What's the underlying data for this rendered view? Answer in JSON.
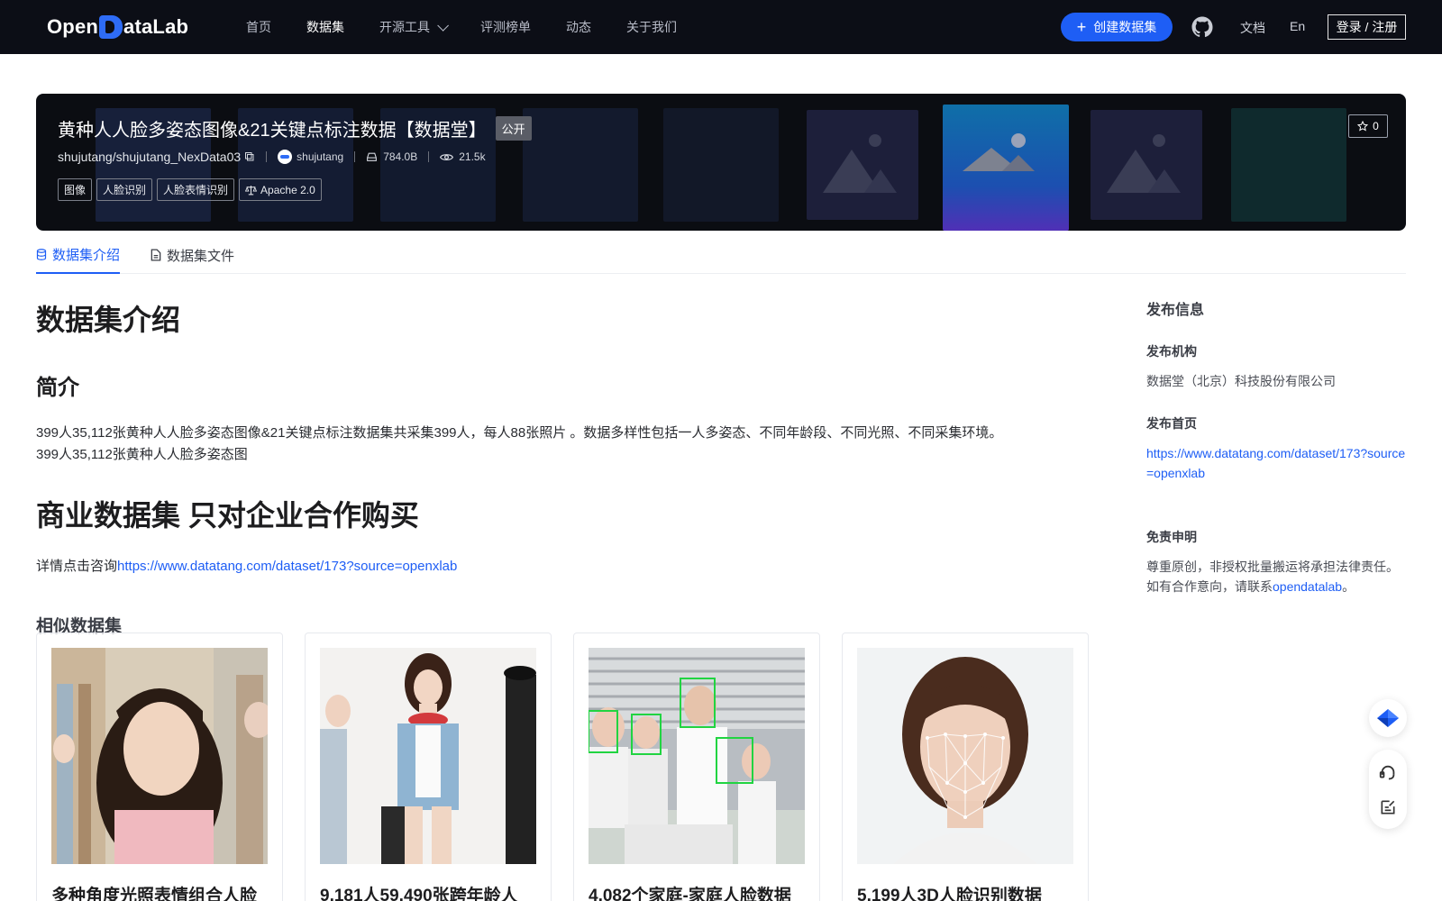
{
  "nav": {
    "logo_text_a": "Open",
    "logo_text_b": "ataLab",
    "links": [
      "首页",
      "数据集",
      "开源工具",
      "评测榜单",
      "动态",
      "关于我们"
    ],
    "active_index": 1,
    "create_label": "创建数据集",
    "docs_label": "文档",
    "lang_label": "En",
    "login_label": "登录 / 注册"
  },
  "dataset": {
    "title": "黄种人人脸多姿态图像&21关键点标注数据【数据堂】",
    "visibility": "公开",
    "star_count": "0",
    "repo": "shujutang/shujutang_NexData03",
    "owner": "shujutang",
    "size": "784.0B",
    "views": "21.5k",
    "tags": [
      "图像",
      "人脸识别",
      "人脸表情识别"
    ],
    "license": "Apache 2.0"
  },
  "tabs": [
    "数据集介绍",
    "数据集文件"
  ],
  "content": {
    "h1": "数据集介绍",
    "h2": "简介",
    "intro_line1": "399人35,112张黄种人人脸多姿态图像&21关键点标注数据集共采集399人，每人88张照片 。数据多样性包括一人多姿态、不同年龄段、不同光照、不同采集环境。",
    "intro_line2": "399人35,112张黄种人人脸多姿态图",
    "commercial": "商业数据集 只对企业合作购买",
    "consult_prefix": "详情点击咨询",
    "consult_link": "https://www.datatang.com/dataset/173?source=openxlab",
    "similar_title": "相似数据集"
  },
  "cards": [
    {
      "title": "多种角度光照表情组合人脸"
    },
    {
      "title": "9,181人59,490张跨年龄人"
    },
    {
      "title": "4,082个家庭-家庭人脸数据"
    },
    {
      "title": "5,199人3D人脸识别数据"
    }
  ],
  "sidebar": {
    "heading": "发布信息",
    "org_label": "发布机构",
    "org_value": "数据堂（北京）科技股份有限公司",
    "home_label": "发布首页",
    "home_link": "https://www.datatang.com/dataset/173?source=openxlab",
    "disclaimer_label": "免责申明",
    "disclaimer_line1": "尊重原创，非授权批量搬运将承担法律责任。",
    "disclaimer_line2_prefix": "如有合作意向，请联系",
    "disclaimer_contact": "opendatalab",
    "disclaimer_line2_suffix": "。"
  },
  "colors": {
    "nav_bg": "#0c0e16",
    "accent": "#1e5ef5",
    "banner_bg": "#0b0d12"
  }
}
